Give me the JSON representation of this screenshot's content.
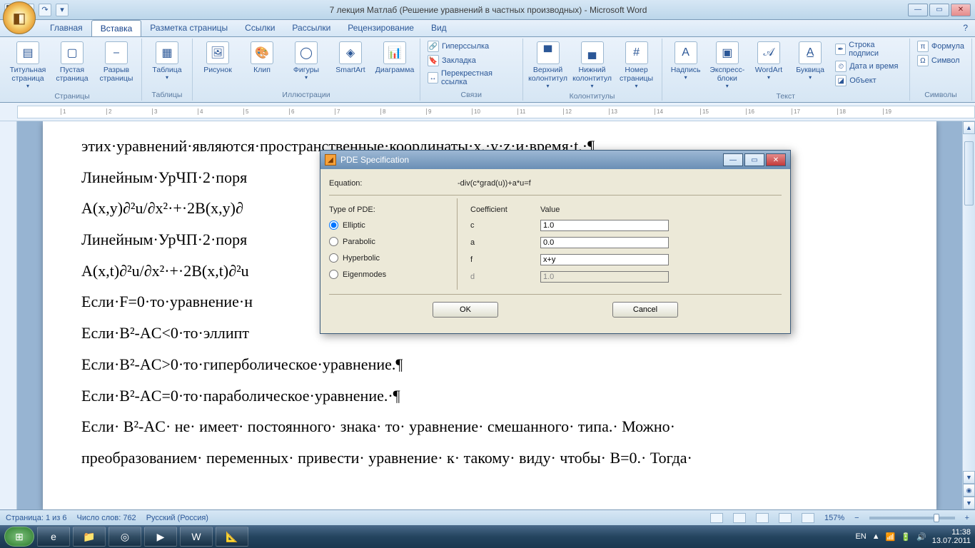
{
  "window": {
    "title": "7 лекция Матлаб (Решение уравнений в частных производных) - Microsoft Word",
    "qat": {
      "save": "💾",
      "undo": "↶",
      "redo": "↷",
      "more": "▾"
    },
    "controls": {
      "min": "—",
      "max": "▭",
      "close": "✕"
    }
  },
  "tabs": {
    "home": "Главная",
    "insert": "Вставка",
    "layout": "Разметка страницы",
    "refs": "Ссылки",
    "mail": "Рассылки",
    "review": "Рецензирование",
    "view": "Вид",
    "help": "?"
  },
  "ribbon": {
    "groups": {
      "pages": "Страницы",
      "tables": "Таблицы",
      "illust": "Иллюстрации",
      "links": "Связи",
      "headfoot": "Колонтитулы",
      "text": "Текст",
      "symbols": "Символы"
    },
    "pages_btn": {
      "cover": "Титульная страница",
      "blank": "Пустая страница",
      "break": "Разрыв страницы"
    },
    "tables_btn": {
      "table": "Таблица"
    },
    "illust_btn": {
      "pic": "Рисунок",
      "clip": "Клип",
      "shapes": "Фигуры",
      "smartart": "SmartArt",
      "chart": "Диаграмма"
    },
    "links_btn": {
      "hyper": "Гиперссылка",
      "bookmark": "Закладка",
      "cross": "Перекрестная ссылка"
    },
    "headfoot_btn": {
      "header": "Верхний колонтитул",
      "footer": "Нижний колонтитул",
      "pagenum": "Номер страницы"
    },
    "text_btn": {
      "textbox": "Надпись",
      "quick": "Экспресс-блоки",
      "wordart": "WordArt",
      "dropcap": "Буквица",
      "sigline": "Строка подписи",
      "datetime": "Дата и время",
      "object": "Объект"
    },
    "symbols_btn": {
      "equation": "Формула",
      "symbol": "Символ"
    }
  },
  "ruler_marks": [
    "1",
    "2",
    "3",
    "4",
    "5",
    "6",
    "7",
    "8",
    "9",
    "10",
    "11",
    "12",
    "13",
    "14",
    "15",
    "16",
    "17",
    "18",
    "19"
  ],
  "document": {
    "p1": "этих·уравнений·являются·пространственные·координаты·x,·y·z·и·время·t.·¶",
    "p2": "Линейным·УрЧП·2·поря",
    "p3": "A(x,y)∂²u/∂x²·+·2B(x,y)∂",
    "p4": "Линейным·УрЧП·2·поря",
    "p5": "A(x,t)∂²u/∂x²·+·2B(x,t)∂²u",
    "p6": "Если·F=0·то·уравнение·н",
    "p7": "Если·B²-AC<0·то·эллипт",
    "p8": "Если·B²-AC>0·то·гиперболическое·уравнение.¶",
    "p9": "Если·B²-AC=0·то·параболическое·уравнение.·¶",
    "p10": "Если· B²-AC· не· имеет· постоянного· знака· то· уравнение· смешанного· типа.· Можно·",
    "p11": "преобразованием· переменных· привести· уравнение· к· такому· виду· чтобы· B=0.· Тогда·"
  },
  "status": {
    "page": "Страница: 1 из 6",
    "words": "Число слов: 762",
    "lang": "Русский (Россия)",
    "zoom": "157%",
    "zoom_plus": "+",
    "zoom_minus": "−"
  },
  "taskbar": {
    "lang": "EN",
    "time": "11:38",
    "date": "13.07.2011"
  },
  "dialog": {
    "title": "PDE Specification",
    "eq_label": "Equation:",
    "eq_value": "-div(c*grad(u))+a*u=f",
    "type_label": "Type of PDE:",
    "coef_label": "Coefficient",
    "val_label": "Value",
    "types": {
      "elliptic": "Elliptic",
      "parabolic": "Parabolic",
      "hyperbolic": "Hyperbolic",
      "eigen": "Eigenmodes"
    },
    "coefs": {
      "c": {
        "label": "c",
        "value": "1.0"
      },
      "a": {
        "label": "a",
        "value": "0.0"
      },
      "f": {
        "label": "f",
        "value": "x+y"
      },
      "d": {
        "label": "d",
        "value": "1.0"
      }
    },
    "ok": "OK",
    "cancel": "Cancel",
    "controls": {
      "min": "—",
      "max": "▭",
      "close": "✕"
    }
  }
}
